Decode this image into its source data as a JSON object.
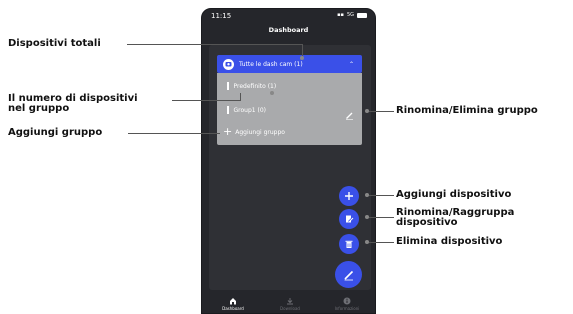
{
  "status_bar": {
    "time": "11:15",
    "network": "5G"
  },
  "screen": {
    "title": "Dashboard"
  },
  "group_list": {
    "header_label": "Tutte le dash cam (1)",
    "rows": [
      {
        "label": "Predefinito (1)"
      },
      {
        "label": "Group1 (0)"
      }
    ],
    "add_group_label": "Aggiungi gruppo"
  },
  "tabs": [
    {
      "label": "Dashboard",
      "icon": "home-icon",
      "active": true
    },
    {
      "label": "Download",
      "icon": "download-icon",
      "active": false
    },
    {
      "label": "Informazioni",
      "icon": "info-icon",
      "active": false
    }
  ],
  "fabs": [
    {
      "icon": "plus-icon"
    },
    {
      "icon": "edit-document-icon"
    },
    {
      "icon": "trash-icon"
    },
    {
      "icon": "pencil-icon"
    }
  ],
  "callouts": {
    "total_devices": "Dispositivi totali",
    "devices_in_group": "Il numero di dispositivi\nnel gruppo",
    "add_group": "Aggiungi gruppo",
    "rename_delete_group": "Rinomina/Elimina gruppo",
    "add_device": "Aggiungi dispositivo",
    "rename_group_device": "Rinomina/Raggruppa\ndispositivo",
    "delete_device": "Elimina dispositivo"
  },
  "colors": {
    "accent": "#3a50e8",
    "background": "#25262b",
    "panel": "#a9aaac"
  }
}
